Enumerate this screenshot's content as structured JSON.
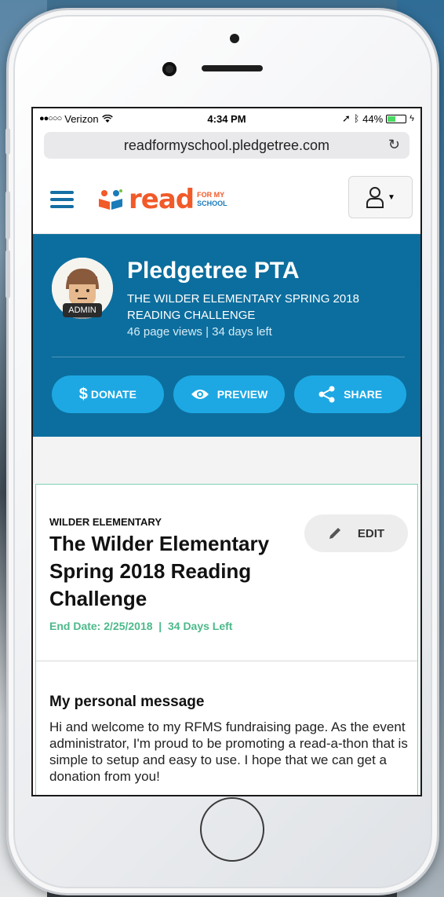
{
  "status_bar": {
    "carrier": "Verizon",
    "time": "4:34 PM",
    "battery": "44%",
    "battery_level": 0.44
  },
  "browser": {
    "url": "readformyschool.pledgetree.com"
  },
  "header": {
    "logo_word": "read",
    "logo_sub_line1": "FOR MY",
    "logo_sub_line2": "SCHOOL"
  },
  "banner": {
    "avatar_badge": "ADMIN",
    "org_name": "Pledgetree PTA",
    "campaign_title": "THE WILDER ELEMENTARY SPRING 2018 READING CHALLENGE",
    "stats": "46 page views | 34 days left",
    "buttons": {
      "donate": "DONATE",
      "preview": "PREVIEW",
      "share": "SHARE"
    }
  },
  "card": {
    "school": "WILDER ELEMENTARY",
    "title": "The Wilder Elementary Spring 2018 Reading Challenge",
    "edit_label": "EDIT",
    "end_date": "End Date: 2/25/2018  |  34 Days Left",
    "message_heading": "My personal message",
    "message_body": "Hi and welcome to my RFMS fundraising page. As the event administrator, I'm proud to be promoting a read-a-thon that is simple to setup and easy to use. I hope that we can get a donation from you!"
  },
  "colors": {
    "brand_blue": "#0c6e9e",
    "button_blue": "#1da8e3",
    "logo_orange": "#f15a29",
    "accent_green": "#4cb98a"
  }
}
